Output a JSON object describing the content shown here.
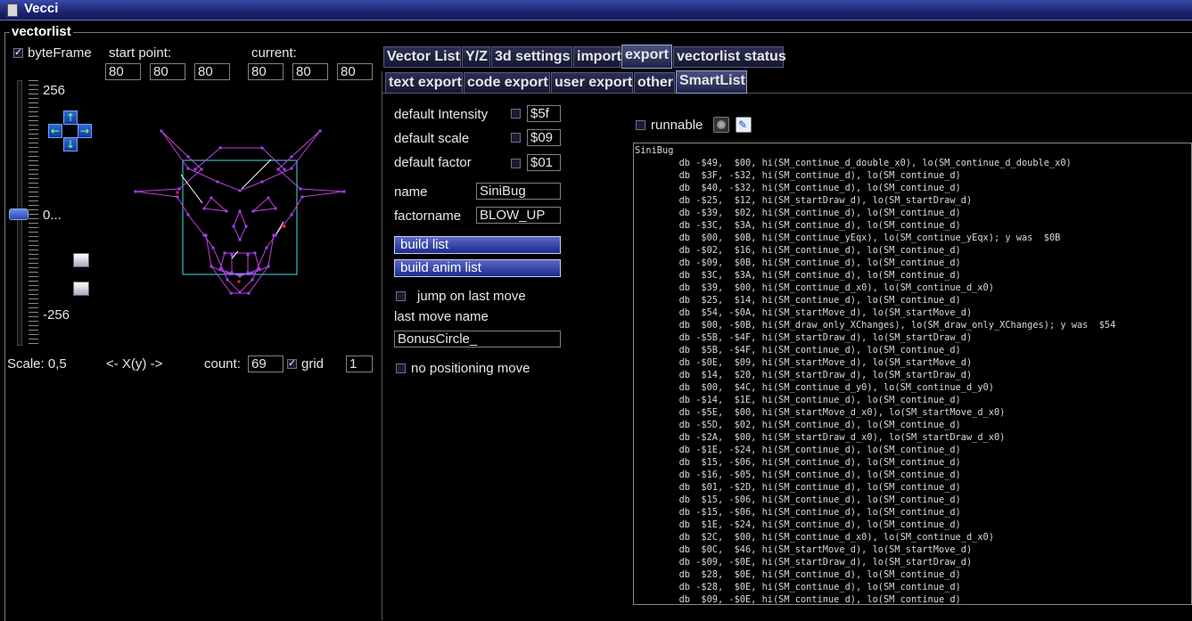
{
  "window": {
    "title": "Vecci"
  },
  "vectorlist": {
    "group_title": "vectorlist",
    "byteframe": {
      "label": "byteFrame",
      "checked": true
    },
    "start_point": {
      "label": "start point:",
      "x": "80",
      "y": "80",
      "z": "80"
    },
    "current": {
      "label": "current:",
      "x": "80",
      "y": "80",
      "z": "80"
    },
    "slider": {
      "max_label": "256",
      "mid_label": "0...",
      "min_label": "-256"
    },
    "scale_label": "Scale: 0,5",
    "axis_label": "<- X(y) ->",
    "count": {
      "label": "count:",
      "value": "69"
    },
    "grid": {
      "label": "grid",
      "checked": true,
      "value": "1"
    }
  },
  "tabs_top": [
    "Vector List",
    "Y/Z",
    "3d settings",
    "import",
    "export",
    "vectorlist status"
  ],
  "tabs_top_active": "export",
  "tabs_sub": [
    "text export",
    "code export",
    "user export",
    "other",
    "SmartList"
  ],
  "tabs_sub_active": "SmartList",
  "smartlist": {
    "default_intensity": {
      "label": "default Intensity",
      "value": "$5f"
    },
    "default_scale": {
      "label": "default scale",
      "value": "$09"
    },
    "default_factor": {
      "label": "default factor",
      "value": "$01"
    },
    "name": {
      "label": "name",
      "value": "SiniBug"
    },
    "factorname": {
      "label": "factorname",
      "value": "BLOW_UP"
    },
    "build_list": "build list",
    "build_anim_list": "build anim list",
    "jump_on_last_move": "jump on last move",
    "last_move_name": {
      "label": "last move name",
      "value": "BonusCircle_"
    },
    "no_positioning_move": "no positioning move",
    "runnable": "runnable"
  },
  "code_lines": [
    "SiniBug",
    "        db -$49,  $00, hi(SM_continue_d_double_x0), lo(SM_continue_d_double_x0)",
    "        db  $3F, -$32, hi(SM_continue_d), lo(SM_continue_d)",
    "        db  $40, -$32, hi(SM_continue_d), lo(SM_continue_d)",
    "        db -$25,  $12, hi(SM_startDraw_d), lo(SM_startDraw_d)",
    "        db -$39,  $02, hi(SM_continue_d), lo(SM_continue_d)",
    "        db -$3C,  $3A, hi(SM_continue_d), lo(SM_continue_d)",
    "        db  $00,  $0B, hi(SM_continue_yEqx), lo(SM_continue_yEqx); y was  $0B",
    "        db -$02,  $16, hi(SM_continue_d), lo(SM_continue_d)",
    "        db -$09,  $0B, hi(SM_continue_d), lo(SM_continue_d)",
    "        db  $3C,  $3A, hi(SM_continue_d), lo(SM_continue_d)",
    "        db  $39,  $00, hi(SM_continue_d_x0), lo(SM_continue_d_x0)",
    "        db  $25,  $14, hi(SM_continue_d), lo(SM_continue_d)",
    "        db  $54, -$0A, hi(SM_startMove_d), lo(SM_startMove_d)",
    "        db  $00, -$0B, hi(SM_draw_only_XChanges), lo(SM_draw_only_XChanges); y was  $54",
    "        db -$5B, -$4F, hi(SM_startDraw_d), lo(SM_startDraw_d)",
    "        db  $5B, -$4F, hi(SM_continue_d), lo(SM_continue_d)",
    "        db -$0E,  $09, hi(SM_startMove_d), lo(SM_startMove_d)",
    "        db  $14,  $20, hi(SM_startDraw_d), lo(SM_startDraw_d)",
    "        db  $00,  $4C, hi(SM_continue_d_y0), lo(SM_continue_d_y0)",
    "        db -$14,  $1E, hi(SM_continue_d), lo(SM_continue_d)",
    "        db -$5E,  $00, hi(SM_startMove_d_x0), lo(SM_startMove_d_x0)",
    "        db -$5D,  $02, hi(SM_continue_d), lo(SM_continue_d)",
    "        db -$2A,  $00, hi(SM_startDraw_d_x0), lo(SM_startDraw_d_x0)",
    "        db -$1E, -$24, hi(SM_continue_d), lo(SM_continue_d)",
    "        db  $15, -$06, hi(SM_continue_d), lo(SM_continue_d)",
    "        db -$16, -$05, hi(SM_continue_d), lo(SM_continue_d)",
    "        db  $01, -$2D, hi(SM_continue_d), lo(SM_continue_d)",
    "        db  $15, -$06, hi(SM_continue_d), lo(SM_continue_d)",
    "        db -$15, -$06, hi(SM_continue_d), lo(SM_continue_d)",
    "        db  $1E, -$24, hi(SM_continue_d), lo(SM_continue_d)",
    "        db  $2C,  $00, hi(SM_continue_d_x0), lo(SM_continue_d_x0)",
    "        db  $0C,  $46, hi(SM_startMove_d), lo(SM_startMove_d)",
    "        db -$09, -$0E, hi(SM_startDraw_d), lo(SM_startDraw_d)",
    "        db  $28,  $0E, hi(SM_continue_d), lo(SM_continue_d)",
    "        db -$28,  $0E, hi(SM_continue_d), lo(SM_continue_d)",
    "        db  $09, -$0E, hi(SM_continue_d), lo(SM_continue_d)"
  ],
  "colors": {
    "title_bar": "#1a2470",
    "vector_line": "#c040e0",
    "vector_point": "#a040ff",
    "selection_box": "#40e0e0",
    "highlight_line": "#ffffff",
    "marker": "#ff2020"
  }
}
